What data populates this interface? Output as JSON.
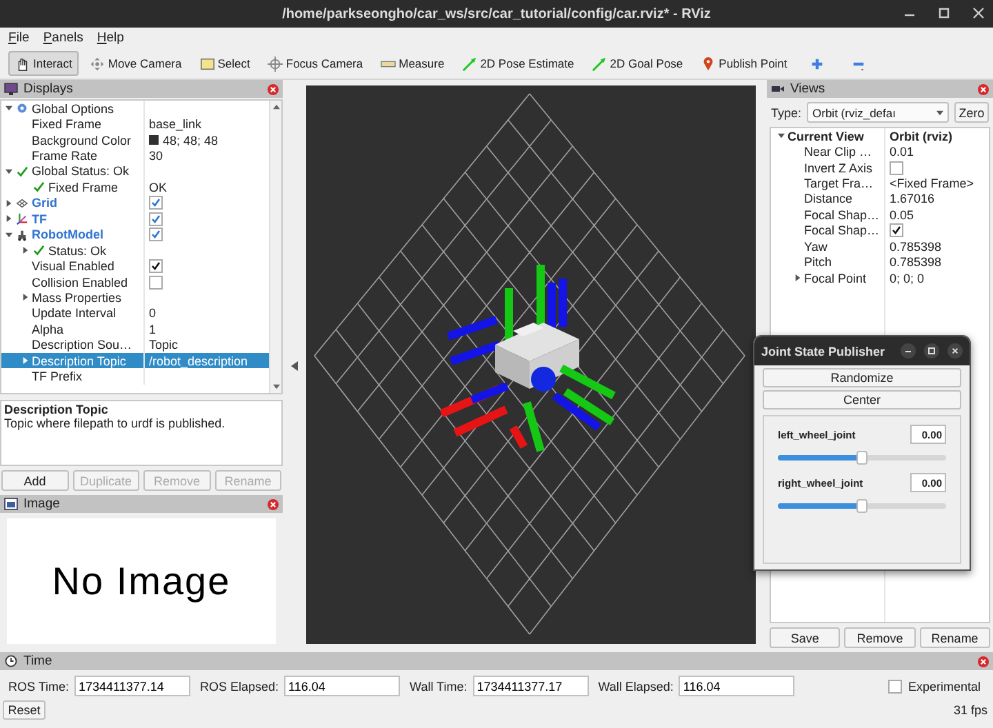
{
  "window": {
    "title": "/home/parkseongho/car_ws/src/car_tutorial/config/car.rviz* - RViz"
  },
  "menu": [
    "File",
    "Panels",
    "Help"
  ],
  "tools": [
    {
      "label": "Interact",
      "kind": "interact",
      "selected": true
    },
    {
      "label": "Move Camera",
      "kind": "move",
      "selected": false
    },
    {
      "label": "Select",
      "kind": "select",
      "selected": false
    },
    {
      "label": "Focus Camera",
      "kind": "focus",
      "selected": false
    },
    {
      "label": "Measure",
      "kind": "measure",
      "selected": false
    },
    {
      "label": "2D Pose Estimate",
      "kind": "pose",
      "selected": false
    },
    {
      "label": "2D Goal Pose",
      "kind": "pose",
      "selected": false
    },
    {
      "label": "Publish Point",
      "kind": "point",
      "selected": false
    }
  ],
  "displays": {
    "title": "Displays",
    "items": [
      {
        "label": "Global Options",
        "kind": "options",
        "expanded": true,
        "selected": false,
        "children": [
          {
            "label": "Fixed Frame",
            "kind": "property",
            "value": "base_link",
            "selected": false
          },
          {
            "label": "Background Color",
            "kind": "property",
            "value": "48; 48; 48",
            "color": "#303030",
            "selected": false
          },
          {
            "label": "Frame Rate",
            "kind": "property",
            "value": "30",
            "selected": false
          }
        ]
      },
      {
        "label": "Global Status: Ok",
        "kind": "status",
        "expanded": true,
        "selected": false,
        "children": [
          {
            "label": "Fixed Frame",
            "kind": "status",
            "value": "OK",
            "selected": false
          }
        ]
      },
      {
        "label": "Grid",
        "kind": "grid",
        "expanded": false,
        "checked": true,
        "selected": false
      },
      {
        "label": "TF",
        "kind": "tf",
        "expanded": false,
        "checked": true,
        "selected": false
      },
      {
        "label": "RobotModel",
        "kind": "robot",
        "expanded": true,
        "checked": true,
        "selected": false,
        "children": [
          {
            "label": "Status: Ok",
            "kind": "status",
            "expanded": false,
            "selected": false
          },
          {
            "label": "Visual Enabled",
            "kind": "property",
            "checked": true,
            "selected": false
          },
          {
            "label": "Collision Enabled",
            "kind": "property",
            "checked": false,
            "selected": false
          },
          {
            "label": "Mass Properties",
            "kind": "property",
            "expanded": false,
            "selected": false
          },
          {
            "label": "Update Interval",
            "kind": "property",
            "value": "0",
            "selected": false
          },
          {
            "label": "Alpha",
            "kind": "property",
            "value": "1",
            "selected": false
          },
          {
            "label": "Description Sou…",
            "kind": "property",
            "value": "Topic",
            "selected": false
          },
          {
            "label": "Description Topic",
            "kind": "property",
            "value": "/robot_description",
            "expanded": false,
            "selected": true
          },
          {
            "label": "TF Prefix",
            "kind": "property",
            "selected": false
          }
        ]
      }
    ],
    "description": {
      "title": "Description Topic",
      "text": "Topic where filepath to urdf is published."
    },
    "buttons": [
      {
        "label": "Add",
        "disabled": false
      },
      {
        "label": "Duplicate",
        "disabled": true
      },
      {
        "label": "Remove",
        "disabled": true
      },
      {
        "label": "Rename",
        "disabled": true
      }
    ]
  },
  "image_panel": {
    "title": "Image",
    "message": "No Image"
  },
  "views": {
    "title": "Views",
    "type_label": "Type:",
    "type_value": "Orbit (rviz_defaı",
    "zero": "Zero",
    "items": [
      {
        "label": "Current View",
        "kind": "header",
        "value": "Orbit (rviz)",
        "expanded": true,
        "selected": false,
        "children": [
          {
            "label": "Near Clip …",
            "kind": "property",
            "value": "0.01",
            "selected": false
          },
          {
            "label": "Invert Z Axis",
            "kind": "property",
            "checked": false,
            "selected": false
          },
          {
            "label": "Target Fra…",
            "kind": "property",
            "value": "<Fixed Frame>",
            "selected": false
          },
          {
            "label": "Distance",
            "kind": "property",
            "value": "1.67016",
            "selected": false
          },
          {
            "label": "Focal Shap…",
            "kind": "property",
            "value": "0.05",
            "selected": false
          },
          {
            "label": "Focal Shap…",
            "kind": "property",
            "checked": true,
            "selected": false
          },
          {
            "label": "Yaw",
            "kind": "property",
            "value": "0.785398",
            "selected": false
          },
          {
            "label": "Pitch",
            "kind": "property",
            "value": "0.785398",
            "selected": false
          },
          {
            "label": "Focal Point",
            "kind": "property",
            "value": "0; 0; 0",
            "expanded": false,
            "selected": false
          }
        ]
      }
    ],
    "buttons": [
      {
        "label": "Save",
        "disabled": false
      },
      {
        "label": "Remove",
        "disabled": false
      },
      {
        "label": "Rename",
        "disabled": false
      }
    ]
  },
  "joint_state_publisher": {
    "title": "Joint State Publisher",
    "buttons": [
      "Randomize",
      "Center"
    ],
    "joints": [
      {
        "name": "left_wheel_joint",
        "value": "0.00",
        "level": 0.5
      },
      {
        "name": "right_wheel_joint",
        "value": "0.00",
        "level": 0.5
      }
    ]
  },
  "time": {
    "title": "Time",
    "fields": [
      {
        "label": "ROS Time:",
        "value": "1734411377.14"
      },
      {
        "label": "ROS Elapsed:",
        "value": "116.04"
      },
      {
        "label": "Wall Time:",
        "value": "1734411377.17"
      },
      {
        "label": "Wall Elapsed:",
        "value": "116.04"
      }
    ],
    "experimental": {
      "label": "Experimental",
      "checked": false
    },
    "reset": "Reset",
    "fps": "31 fps"
  }
}
